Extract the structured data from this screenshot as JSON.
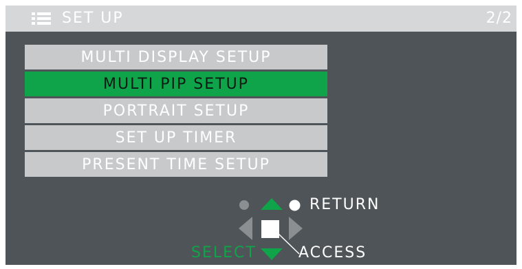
{
  "header": {
    "icon": "menu-list-icon",
    "title": "SET UP",
    "page_indicator": "2/2"
  },
  "menu": {
    "items": [
      {
        "label": "MULTI DISPLAY SETUP",
        "selected": false
      },
      {
        "label": "MULTI PIP SETUP",
        "selected": true
      },
      {
        "label": "PORTRAIT SETUP",
        "selected": false
      },
      {
        "label": "SET UP TIMER",
        "selected": false
      },
      {
        "label": "PRESENT TIME SETUP",
        "selected": false
      }
    ]
  },
  "controls": {
    "return_label": "RETURN",
    "select_label": "SELECT",
    "access_label": "ACCESS",
    "icons": [
      "up-arrow-icon",
      "down-arrow-icon",
      "left-arrow-icon",
      "right-arrow-icon",
      "enter-square-icon",
      "return-dot-icon",
      "inactive-dot-icon"
    ]
  },
  "colors": {
    "background": "#4e5457",
    "titlebar": "#d5d7d8",
    "menu_item": "#c7c9cb",
    "selected": "#0fa44a",
    "text": "#ffffff"
  }
}
